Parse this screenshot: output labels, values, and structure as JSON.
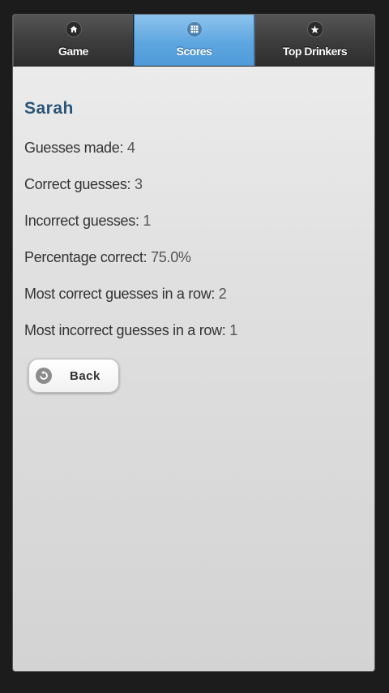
{
  "navbar": {
    "tabs": [
      {
        "label": "Game",
        "icon": "home-icon",
        "active": false
      },
      {
        "label": "Scores",
        "icon": "grid-icon",
        "active": true
      },
      {
        "label": "Top Drinkers",
        "icon": "star-icon",
        "active": false
      }
    ]
  },
  "player": {
    "name": "Sarah"
  },
  "stats": [
    {
      "label": "Guesses made: ",
      "value": "4"
    },
    {
      "label": "Correct guesses: ",
      "value": "3"
    },
    {
      "label": "Incorrect guesses: ",
      "value": "1"
    },
    {
      "label": "Percentage correct: ",
      "value": "75.0%"
    },
    {
      "label": "Most correct guesses in a row: ",
      "value": "2"
    },
    {
      "label": "Most incorrect guesses in a row: ",
      "value": "1"
    }
  ],
  "back_button": {
    "label": "Back",
    "icon": "back-arrow-icon"
  },
  "colors": {
    "active_tab": "#5ea6e0",
    "name_color": "#2b5577"
  }
}
